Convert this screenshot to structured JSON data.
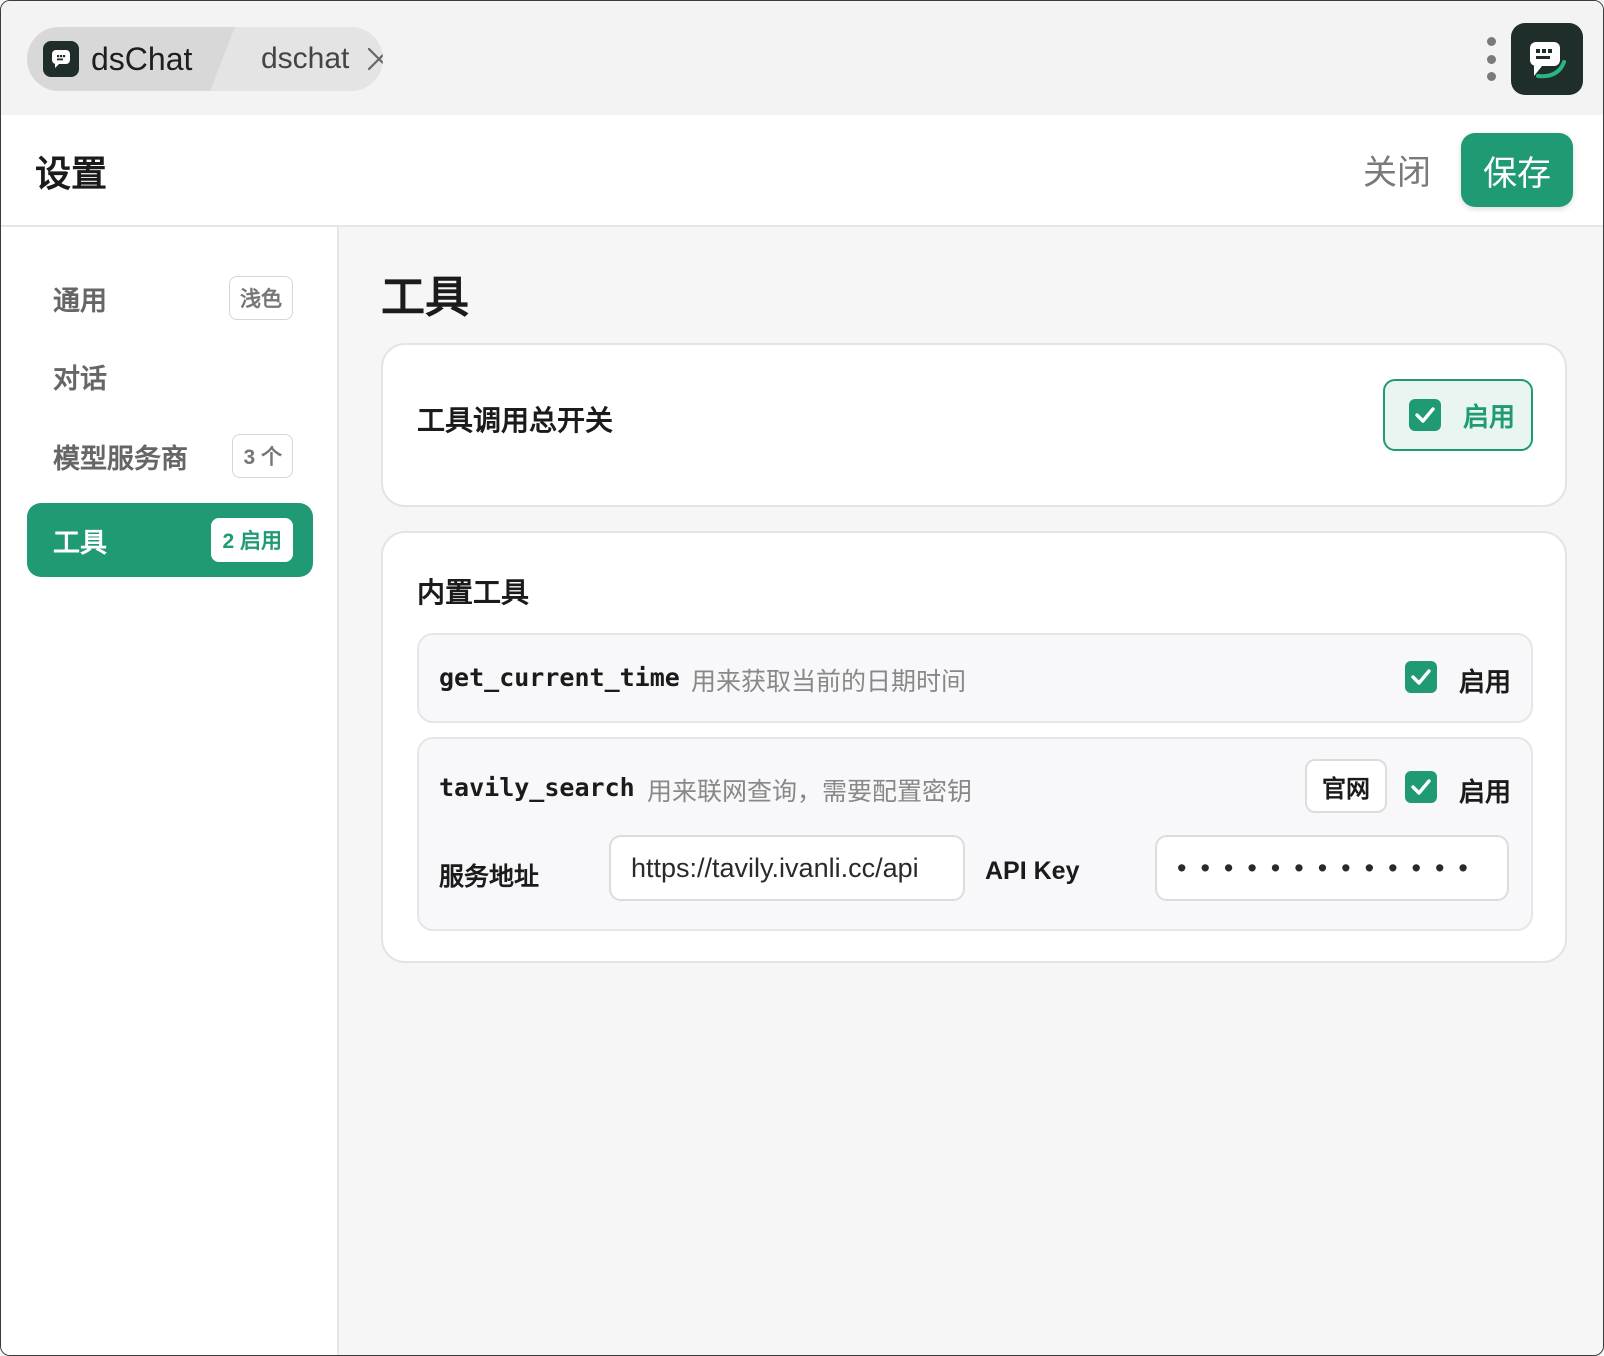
{
  "tabbar": {
    "app_tab_title": "dsChat",
    "doc_tab_title": "dschat"
  },
  "header": {
    "title": "设置",
    "close_label": "关闭",
    "save_label": "保存"
  },
  "sidebar": {
    "items": [
      {
        "label": "通用",
        "badge": "浅色",
        "active": false
      },
      {
        "label": "对话",
        "badge": "",
        "active": false
      },
      {
        "label": "模型服务商",
        "badge": "3 个",
        "active": false
      },
      {
        "label": "工具",
        "badge": "2 启用",
        "active": true
      }
    ]
  },
  "main": {
    "title": "工具",
    "master_switch": {
      "title": "工具调用总开关",
      "toggle_label": "启用",
      "checked": true
    },
    "builtin": {
      "title": "内置工具",
      "tools": [
        {
          "name": "get_current_time",
          "description": "用来获取当前的日期时间",
          "enable_label": "启用",
          "checked": true
        },
        {
          "name": "tavily_search",
          "description": "用来联网查询，需要配置密钥",
          "site_label": "官网",
          "enable_label": "启用",
          "checked": true,
          "service_url_label": "服务地址",
          "service_url_value": "https://tavily.ivanli.cc/api",
          "api_key_label": "API Key",
          "api_key_value": "•••••••••••••"
        }
      ]
    }
  },
  "colors": {
    "accent": "#1f9a74",
    "accent_light": "#e8f5f0",
    "logo_bg": "#1f2d2b"
  },
  "icons": {
    "app_logo": "chat-bubble-logo-icon",
    "close": "close-icon",
    "menu": "more-vertical-icon",
    "check": "check-icon"
  }
}
